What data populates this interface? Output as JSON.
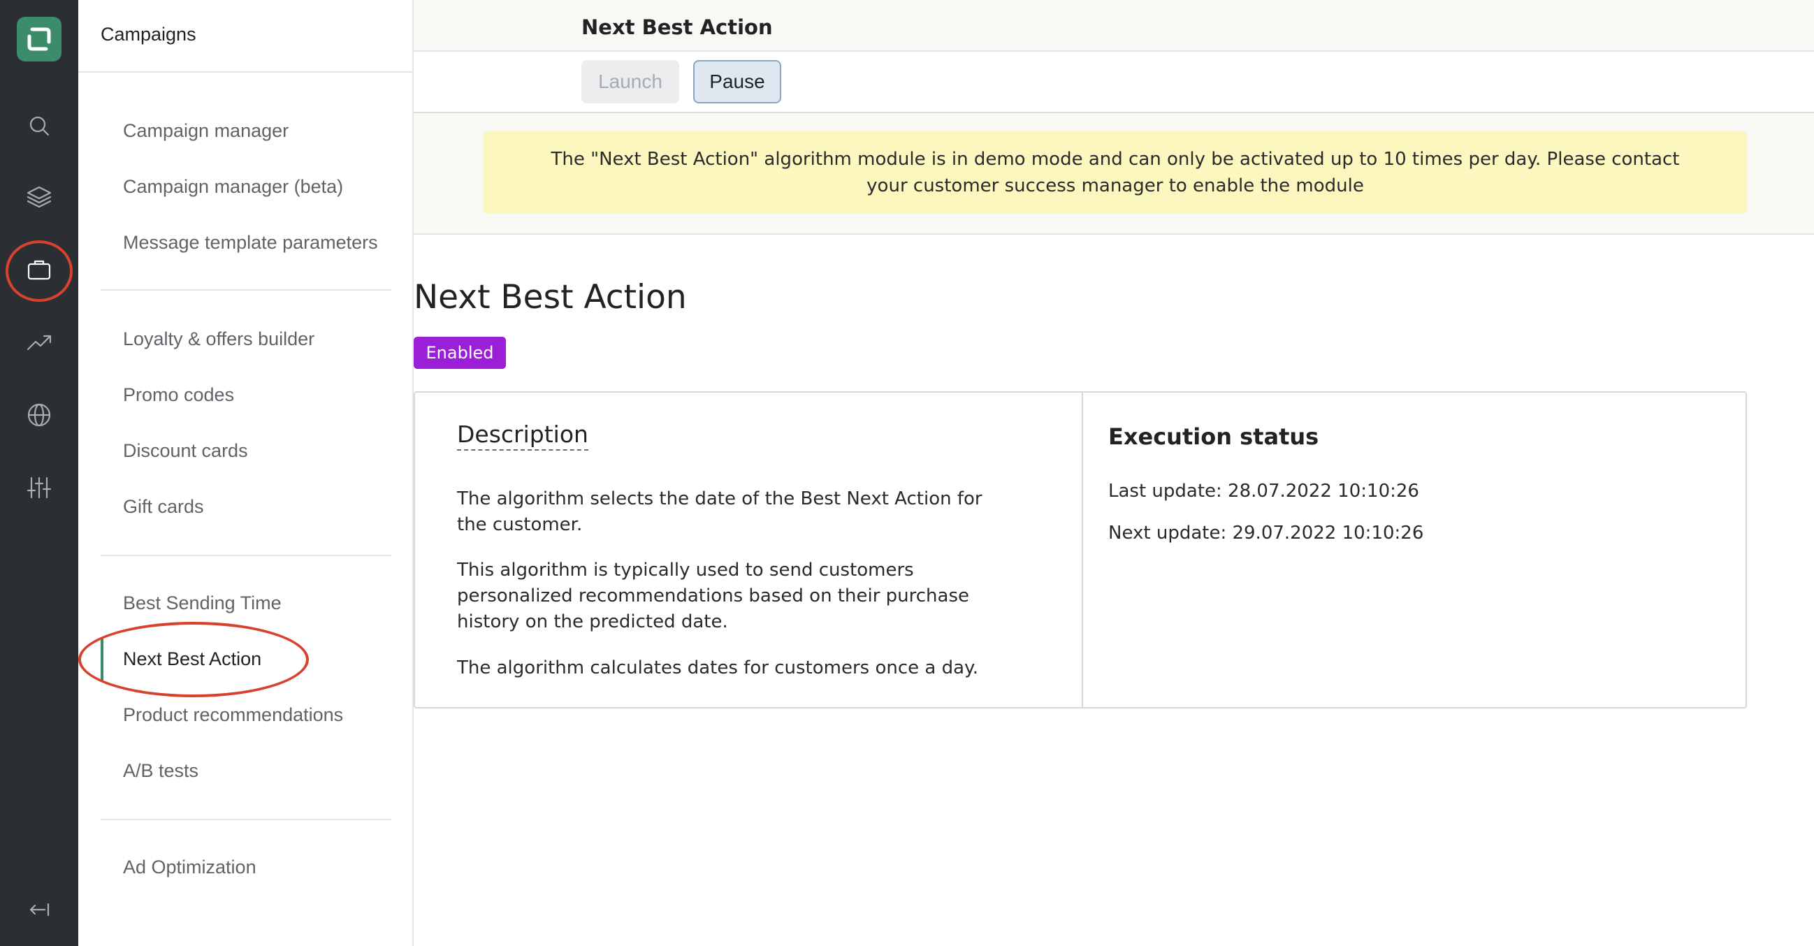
{
  "rail": {
    "items": [
      {
        "icon": "search-icon"
      },
      {
        "icon": "layers-icon"
      },
      {
        "icon": "briefcase-icon"
      },
      {
        "icon": "trending-icon"
      },
      {
        "icon": "globe-icon"
      },
      {
        "icon": "sliders-icon"
      }
    ],
    "active_icon": "briefcase-icon",
    "accent_color": "#3c8c6a",
    "highlight_color": "#d7422e"
  },
  "subnav": {
    "title": "Campaigns",
    "groups": [
      [
        "Campaign manager",
        "Campaign manager (beta)",
        "Message template parameters"
      ],
      [
        "Loyalty & offers builder",
        "Promo codes",
        "Discount cards",
        "Gift cards"
      ],
      [
        "Best Sending Time",
        "Next Best Action",
        "Product recommendations",
        "A/B tests"
      ],
      [
        "Ad Optimization"
      ]
    ],
    "active_item": "Next Best Action"
  },
  "header": {
    "title": "Next Best Action",
    "launch_label": "Launch",
    "pause_label": "Pause"
  },
  "banner": {
    "text": "The \"Next Best Action\" algorithm module is in demo mode and can only be activated up to 10 times per day. Please contact your customer success manager to enable the module",
    "color": "#fbf7be"
  },
  "page": {
    "title": "Next Best Action",
    "status_badge": "Enabled",
    "badge_color": "#9b1fd6"
  },
  "description": {
    "title": "Description",
    "paragraphs": [
      "The algorithm selects the date of the Best Next Action for the customer.",
      "This algorithm is typically used to send customers personalized recommendations based on their purchase history on the predicted date.",
      "The algorithm calculates dates for customers once a day."
    ]
  },
  "execution": {
    "title": "Execution status",
    "last_update": "Last update: 28.07.2022 10:10:26",
    "next_update": "Next update: 29.07.2022 10:10:26"
  }
}
